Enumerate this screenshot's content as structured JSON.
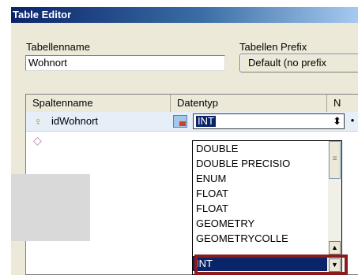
{
  "window": {
    "title": "Table Editor"
  },
  "table_name": {
    "label": "Tabellenname",
    "value": "Wohnort"
  },
  "table_prefix": {
    "label": "Tabellen Prefix",
    "button": "Default (no prefix"
  },
  "columns": {
    "headers": [
      "Spaltenname",
      "Datentyp",
      "N"
    ]
  },
  "rows": [
    {
      "name": "idWohnort",
      "type": "INT",
      "icon": "key-icon"
    },
    {
      "name": "",
      "type": "",
      "icon": "diamond-icon"
    }
  ],
  "combo_arrows": "⬍",
  "row_end_glyph": "•",
  "dropdown": {
    "options": [
      "DOUBLE",
      "DOUBLE PRECISIO",
      "ENUM",
      "FLOAT",
      "FLOAT",
      "GEOMETRY",
      "GEOMETRYCOLLE",
      "INT"
    ],
    "selected": "INT"
  },
  "colors": {
    "highlight_frame": "#8b1a1a",
    "selection": "#0a246a",
    "titlebar": "#0a246a"
  }
}
